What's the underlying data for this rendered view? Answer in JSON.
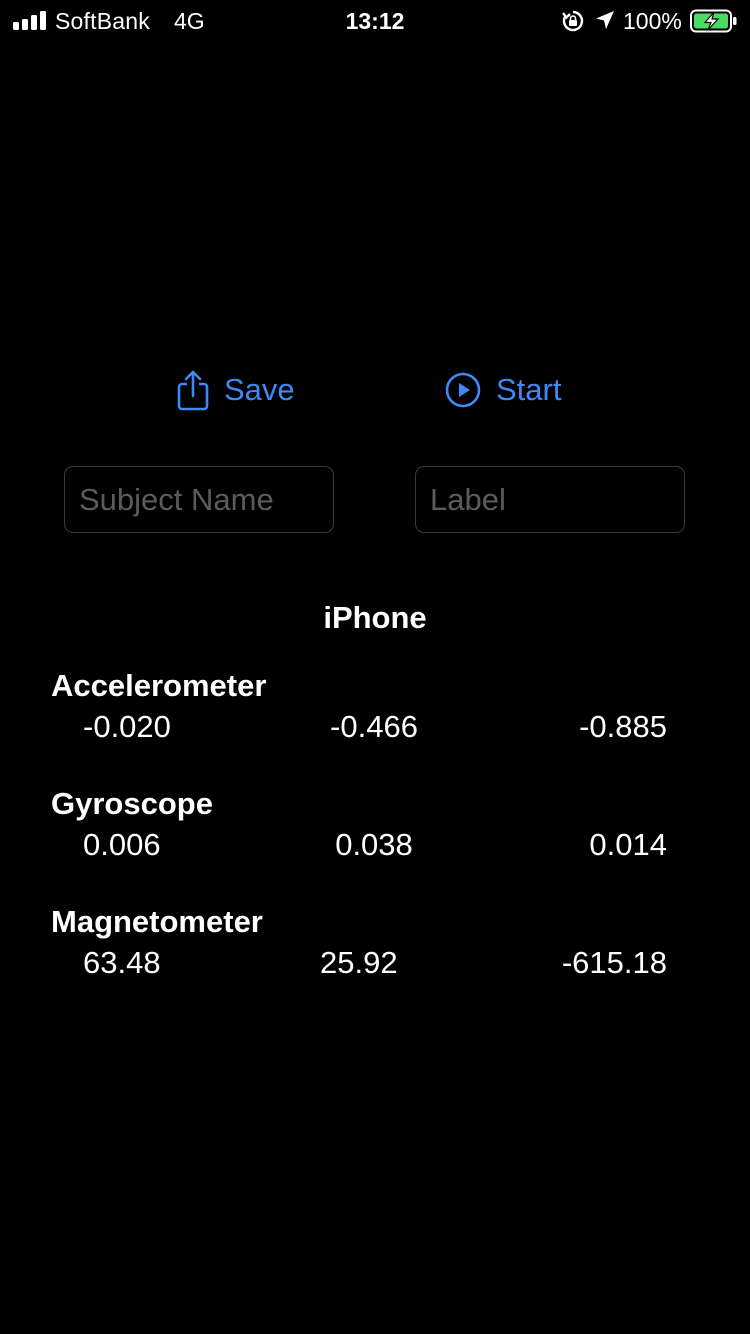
{
  "status_bar": {
    "carrier": "SoftBank",
    "network": "4G",
    "time": "13:12",
    "battery_percent": "100%",
    "icons": [
      "signal-bars-icon",
      "rotation-lock-icon",
      "location-arrow-icon",
      "battery-charging-icon"
    ]
  },
  "actions": {
    "save_label": "Save",
    "save_icon": "share-icon",
    "start_label": "Start",
    "start_icon": "play-circle-icon",
    "accent_color": "#3d8af7"
  },
  "fields": {
    "subject_placeholder": "Subject Name",
    "subject_value": "",
    "label_placeholder": "Label",
    "label_value": ""
  },
  "sensors": {
    "device": "iPhone",
    "accelerometer": {
      "name": "Accelerometer",
      "values": [
        "-0.020",
        "-0.466",
        "-0.885"
      ]
    },
    "gyroscope": {
      "name": "Gyroscope",
      "values": [
        "0.006",
        "0.038",
        "0.014"
      ]
    },
    "magnetometer": {
      "name": "Magnetometer",
      "values": [
        "63.48",
        "25.92",
        "-615.18"
      ]
    }
  }
}
